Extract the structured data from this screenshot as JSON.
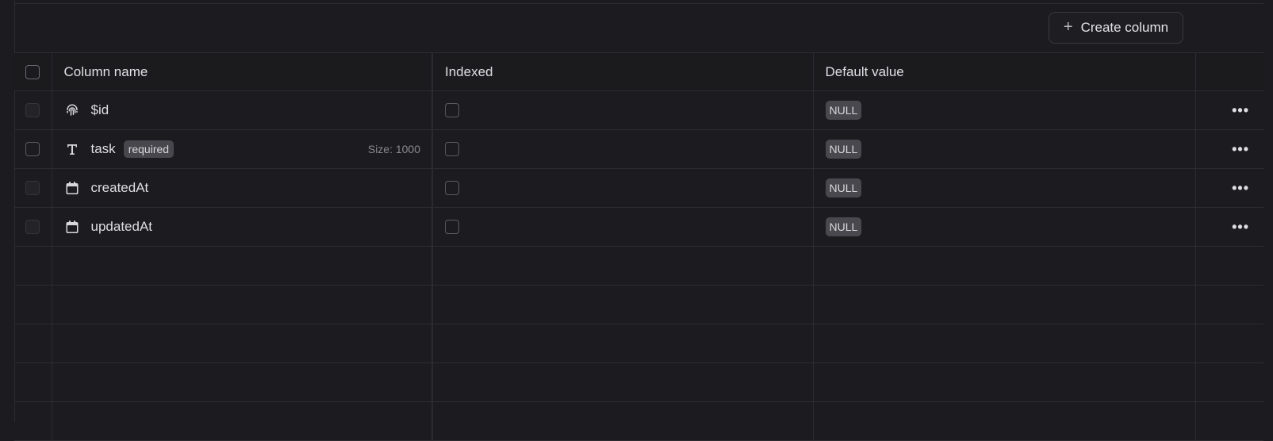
{
  "toolbar": {
    "create_column_label": "Create column",
    "create_column_icon": "plus-icon"
  },
  "table": {
    "headers": {
      "name": "Column name",
      "indexed": "Indexed",
      "default": "Default value"
    },
    "rows": [
      {
        "name": "$id",
        "icon": "fingerprint-icon",
        "badge": "",
        "size": "",
        "indexed": false,
        "default": "NULL"
      },
      {
        "name": "task",
        "icon": "text-type-icon",
        "badge": "required",
        "size": "Size: 1000",
        "indexed": false,
        "default": "NULL"
      },
      {
        "name": "createdAt",
        "icon": "calendar-icon",
        "badge": "",
        "size": "",
        "indexed": false,
        "default": "NULL"
      },
      {
        "name": "updatedAt",
        "icon": "calendar-icon",
        "badge": "",
        "size": "",
        "indexed": false,
        "default": "NULL"
      }
    ],
    "more_icon": "more-horizontal-icon"
  },
  "colors": {
    "background": "#1c1c20",
    "header_background": "#1b1b1e",
    "badge_background": "#48484e",
    "border": "#2c2c31"
  }
}
